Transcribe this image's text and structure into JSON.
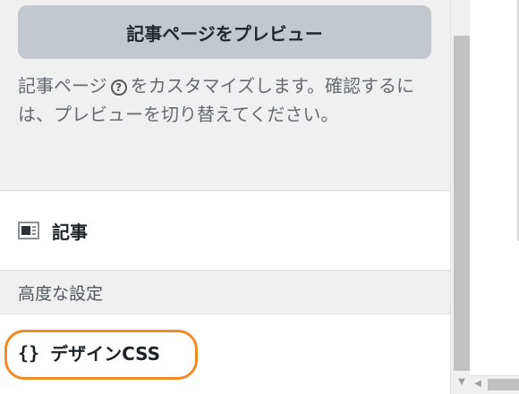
{
  "preview_button": {
    "label": "記事ページをプレビュー"
  },
  "description": {
    "prefix": "記事ページ",
    "help_glyph": "?",
    "suffix": "をカスタマイズします。確認するには、プレビューを切り替えてください。"
  },
  "sections": {
    "article": {
      "label": "記事",
      "icon": "article-layout-icon"
    },
    "advanced": {
      "label": "高度な設定"
    },
    "css": {
      "label": "デザインCSS",
      "icon_glyph": "{}",
      "highlight_color": "#f08a24"
    }
  },
  "scrollbar": {
    "down_arrow": "▼",
    "left_arrow": "◀"
  }
}
